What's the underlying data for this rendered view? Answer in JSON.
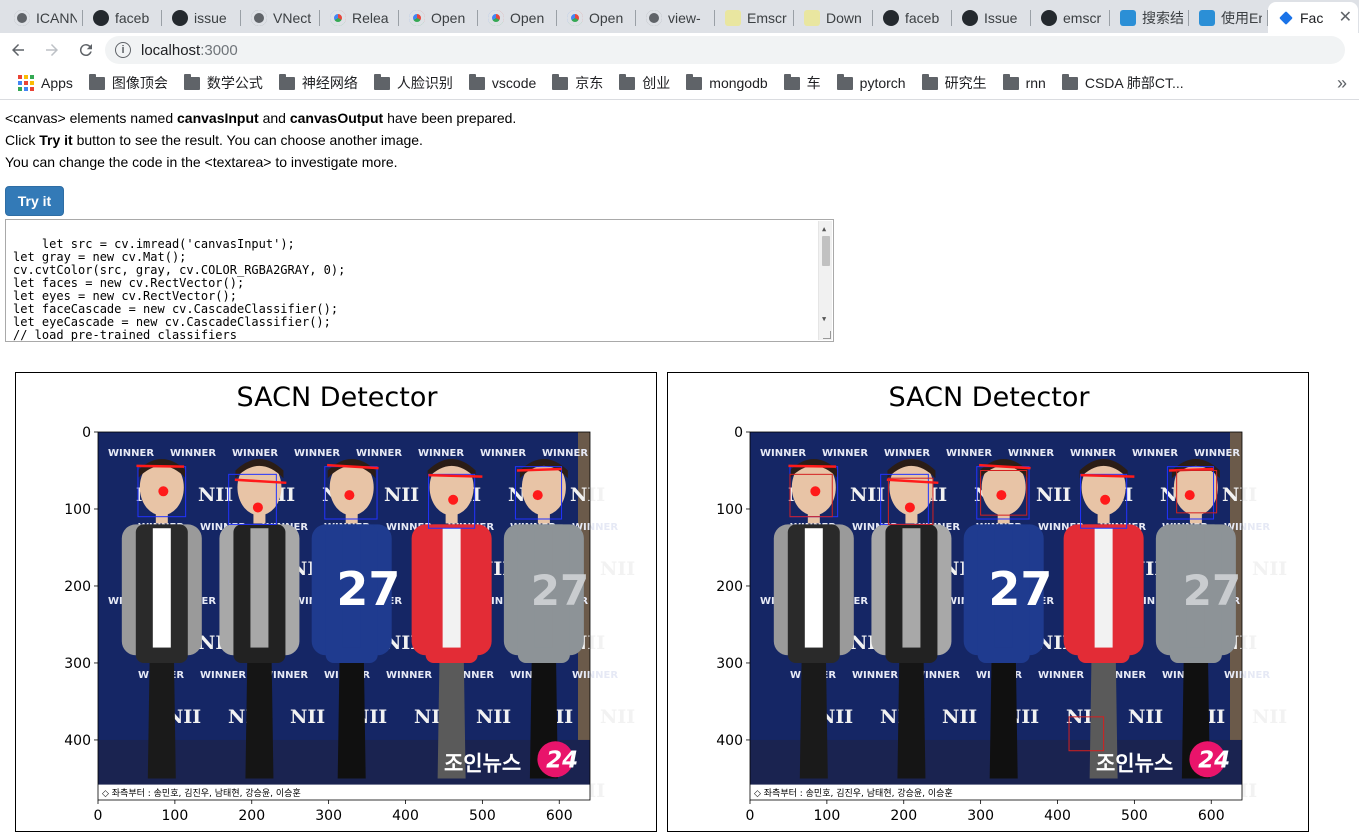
{
  "browser": {
    "tabs": [
      {
        "icon": "globe-icon",
        "label": "ICANN"
      },
      {
        "icon": "github-icon",
        "label": "faceb"
      },
      {
        "icon": "github-icon",
        "label": "issue"
      },
      {
        "icon": "globe-icon",
        "label": "VNect"
      },
      {
        "icon": "opencv-icon",
        "label": "Relea"
      },
      {
        "icon": "opencv-icon",
        "label": "Open"
      },
      {
        "icon": "opencv-icon",
        "label": "Open"
      },
      {
        "icon": "opencv-icon",
        "label": "Open"
      },
      {
        "icon": "globe-icon",
        "label": "view-"
      },
      {
        "icon": "emscripten-icon",
        "label": "Emscr"
      },
      {
        "icon": "emscripten-icon",
        "label": "Down"
      },
      {
        "icon": "github-icon",
        "label": "faceb"
      },
      {
        "icon": "github-icon",
        "label": "Issue"
      },
      {
        "icon": "github-icon",
        "label": "emscr"
      },
      {
        "icon": "paw-icon",
        "label": "搜索结"
      },
      {
        "icon": "paw-icon",
        "label": "使用Em"
      }
    ],
    "active_tab": {
      "icon": "chevron-icon",
      "label": "Fac"
    },
    "url_host": "localhost",
    "url_port": ":3000",
    "bookmarks": [
      {
        "label": "Apps",
        "icon": "apps-grid-icon"
      },
      {
        "label": "图像顶会"
      },
      {
        "label": "数学公式"
      },
      {
        "label": "神经网络"
      },
      {
        "label": "人脸识别"
      },
      {
        "label": "vscode"
      },
      {
        "label": "京东"
      },
      {
        "label": "创业"
      },
      {
        "label": "mongodb"
      },
      {
        "label": "车"
      },
      {
        "label": "pytorch"
      },
      {
        "label": "研究生"
      },
      {
        "label": "rnn"
      },
      {
        "label": "CSDA 肺部CT..."
      }
    ],
    "bookmarks_overflow": "»"
  },
  "page": {
    "intro_line1_a": "<canvas> elements named ",
    "intro_line1_b": "canvasInput",
    "intro_line1_c": " and ",
    "intro_line1_d": "canvasOutput",
    "intro_line1_e": " have been prepared.",
    "intro_line2_a": "Click ",
    "intro_line2_b": "Try it",
    "intro_line2_c": " button to see the result. You can choose another image.",
    "intro_line3": "You can change the code in the <textarea> to investigate more.",
    "try_button": "Try it",
    "code": "let src = cv.imread('canvasInput');\nlet gray = new cv.Mat();\ncv.cvtColor(src, gray, cv.COLOR_RGBA2GRAY, 0);\nlet faces = new cv.RectVector();\nlet eyes = new cv.RectVector();\nlet faceCascade = new cv.CascadeClassifier();\nlet eyeCascade = new cv.CascadeClassifier();\n// load pre-trained classifiers\nfaceCascade.load('haarcascade_frontalface_default.xml');"
  },
  "figures": [
    {
      "title": "SACN Detector",
      "xticks": [
        "0",
        "100",
        "200",
        "300",
        "400",
        "500",
        "600"
      ],
      "yticks": [
        "0",
        "100",
        "200",
        "300",
        "400"
      ],
      "photo_caption": "◇ 좌측부터 : 송민호, 김진우, 남태현, 강승윤, 이승훈",
      "photo_logo": "조인뉴스",
      "photo_logo_num": "24",
      "jersey": "27",
      "backdrop_text": "WINNER",
      "backdrop_logo": "NII"
    },
    {
      "title": "SACN Detector",
      "xticks": [
        "0",
        "100",
        "200",
        "300",
        "400",
        "500",
        "600"
      ],
      "yticks": [
        "0",
        "100",
        "200",
        "300",
        "400"
      ],
      "photo_caption": "◇ 좌측부터 : 송민호, 김진우, 남태현, 강승윤, 이승훈",
      "photo_logo": "조인뉴스",
      "photo_logo_num": "24",
      "jersey": "27",
      "backdrop_text": "WINNER",
      "backdrop_logo": "NII"
    }
  ]
}
